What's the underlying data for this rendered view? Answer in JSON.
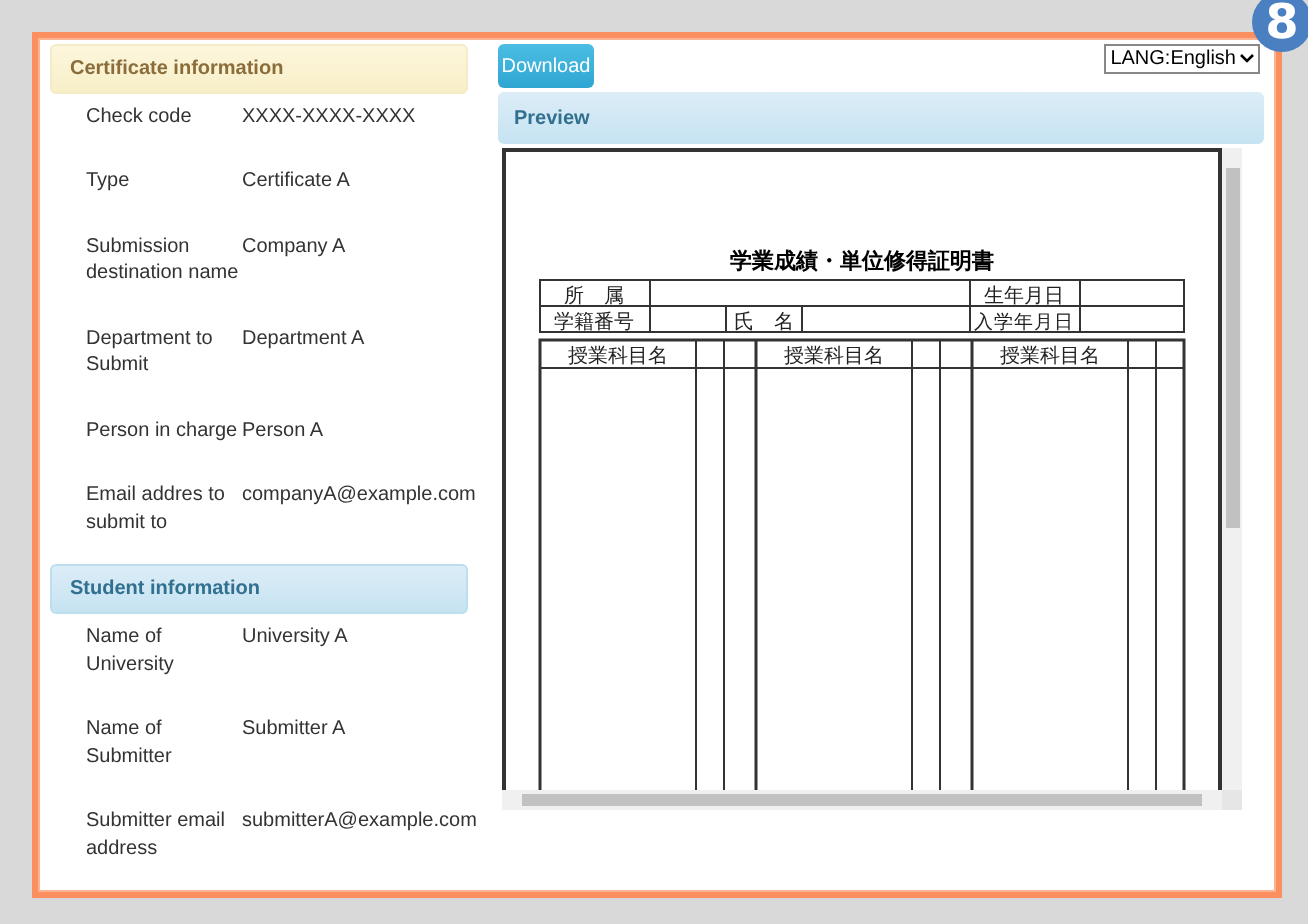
{
  "badge": "8",
  "certificate_section": {
    "title": "Certificate information",
    "fields": [
      {
        "label": "Check code",
        "value": "XXXX-XXXX-XXXX"
      },
      {
        "label": "Type",
        "value": "Certificate A"
      },
      {
        "label": "Submission destination name",
        "value": "Company A"
      },
      {
        "label": "Department to Submit",
        "value": "Department A"
      },
      {
        "label": "Person in charge",
        "value": "Person A"
      },
      {
        "label": "Email addres to submit to",
        "value": "companyA@example.com"
      }
    ]
  },
  "student_section": {
    "title": "Student information",
    "fields": [
      {
        "label": "Name of University",
        "value": "University A"
      },
      {
        "label": "Name of Submitter",
        "value": "Submitter A"
      },
      {
        "label": "Submitter email address",
        "value": "submitterA@example.com"
      }
    ]
  },
  "download_button": "Download",
  "language_select": {
    "value": "LANG:English"
  },
  "preview": {
    "title": "Preview",
    "document": {
      "title": "学業成績・単位修得証明書",
      "info_labels": [
        "所　属",
        "生年月日",
        "学籍番号",
        "氏　名",
        "入学年月日"
      ],
      "column_headers": [
        "授業科目名",
        "授業科目名",
        "授業科目名"
      ]
    }
  }
}
